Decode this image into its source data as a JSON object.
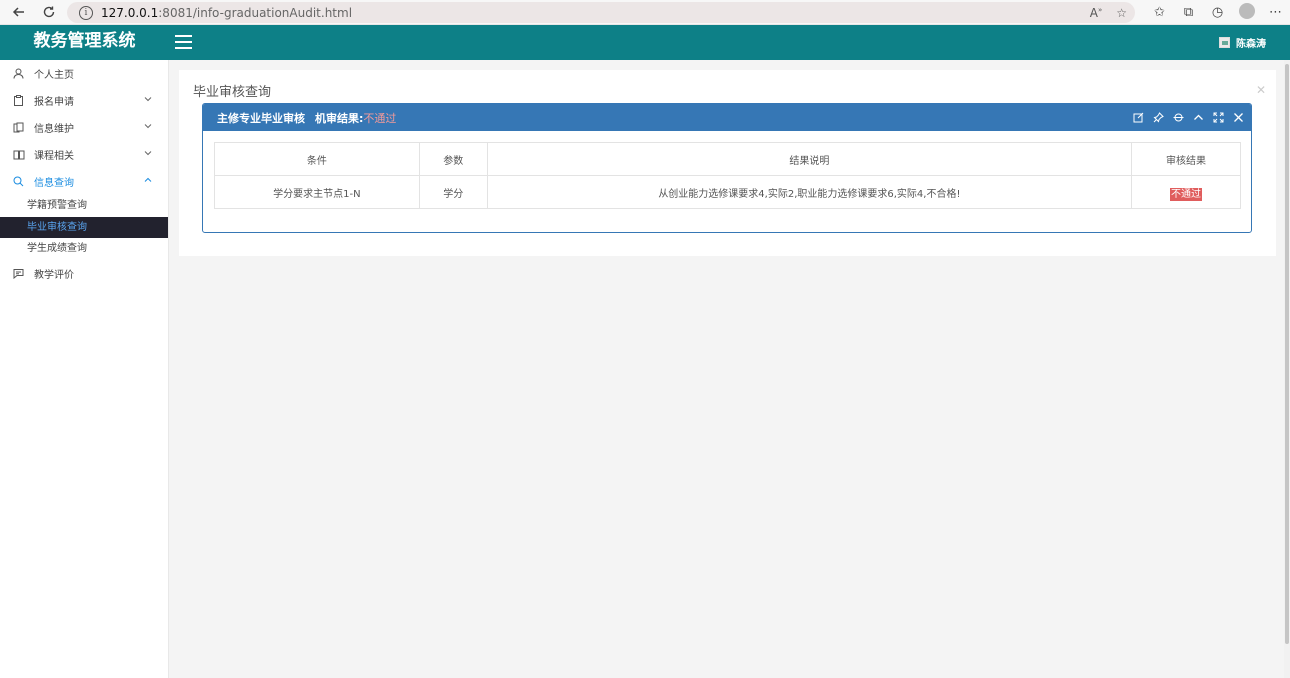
{
  "browser": {
    "url_host": "127.0.0.1",
    "url_path": ":8081/info-graduationAudit.html"
  },
  "header": {
    "logo": "教务管理系统",
    "user_name": "陈森涛"
  },
  "sidebar": {
    "items": [
      {
        "label": "个人主页",
        "icon": "user-icon",
        "has_arrow": false
      },
      {
        "label": "报名申请",
        "icon": "clipboard-icon",
        "has_arrow": true
      },
      {
        "label": "信息维护",
        "icon": "copy-icon",
        "has_arrow": true
      },
      {
        "label": "课程相关",
        "icon": "book-icon",
        "has_arrow": true
      },
      {
        "label": "信息查询",
        "icon": "search-icon",
        "has_arrow": true,
        "active": true
      },
      {
        "label": "教学评价",
        "icon": "message-icon",
        "has_arrow": false
      }
    ],
    "submenu": [
      {
        "label": "学籍预警查询"
      },
      {
        "label": "毕业审核查询",
        "selected": true
      },
      {
        "label": "学生成绩查询"
      }
    ]
  },
  "main": {
    "panel_title": "毕业审核查询",
    "box_title": "主修专业毕业审核",
    "box_result_label": "机审结果:",
    "box_result_value": "不通过",
    "table": {
      "headers": [
        "条件",
        "参数",
        "结果说明",
        "审核结果"
      ],
      "rows": [
        [
          "学分要求主节点1-N",
          "学分",
          "从创业能力选修课要求4,实际2,职业能力选修课要求6,实际4,不合格!",
          "不通过"
        ]
      ]
    }
  },
  "colors": {
    "header_bg": "#0d8087",
    "box_header_bg": "#3677b5",
    "active_menu": "#1a8ce0",
    "fail": "#e05d5d"
  }
}
